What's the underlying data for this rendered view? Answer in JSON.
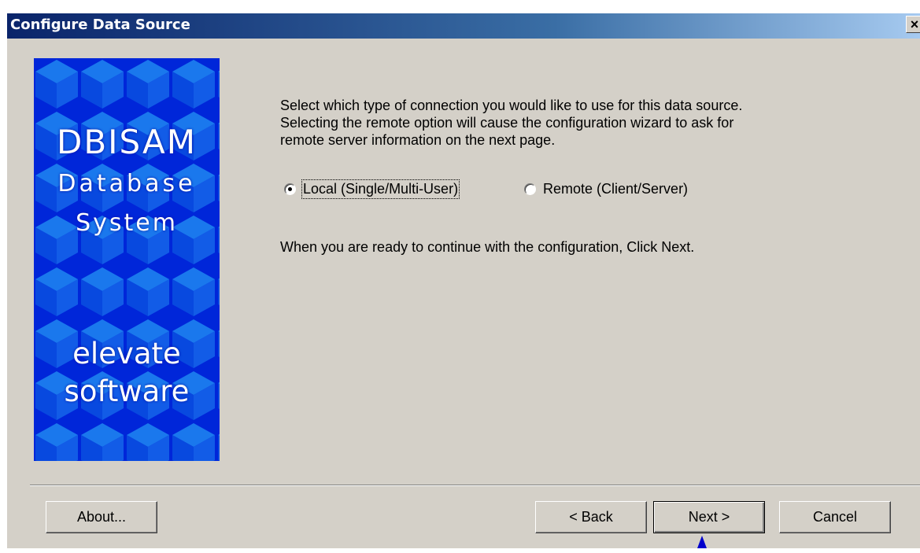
{
  "window": {
    "title": "Configure Data Source",
    "close_glyph": "×"
  },
  "banner": {
    "title": "DBISAM",
    "subtitle_line1": "Database",
    "subtitle_line2": "System",
    "vendor_line1": "elevate",
    "vendor_line2": "software",
    "background_color": "#0026d9",
    "pattern_color": "#1e86f0"
  },
  "content": {
    "intro_lines": [
      "Select which type of connection you would like to use for this data source.",
      "Selecting the remote option will cause the configuration wizard to ask for",
      "remote server information on the next page."
    ],
    "connection_options": [
      {
        "label": "Local (Single/Multi-User)",
        "checked": true
      },
      {
        "label": "Remote (Client/Server)",
        "checked": false
      }
    ],
    "ready_text": "When you are ready to continue with the configuration, Click Next."
  },
  "buttons": {
    "about": "About...",
    "back": "< Back",
    "next": "Next >",
    "cancel": "Cancel"
  },
  "icons": {
    "close": "close-icon",
    "pointer": "mouse-pointer-icon"
  },
  "colors": {
    "dialog_face": "#d4d0c8",
    "titlebar_start": "#0a246a",
    "titlebar_end": "#a6caf0"
  }
}
